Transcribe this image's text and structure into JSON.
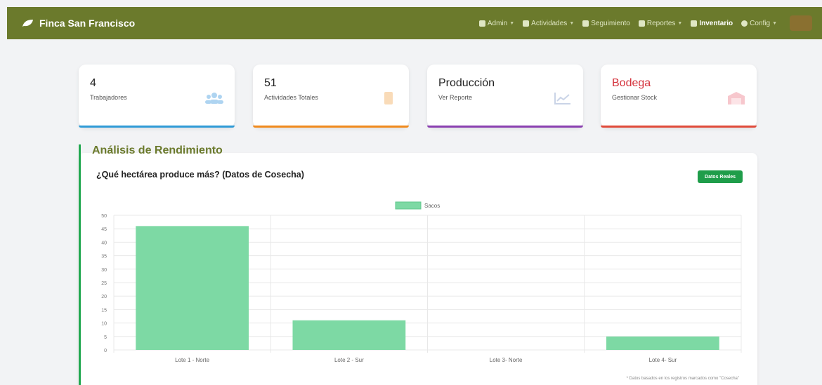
{
  "navbar": {
    "brand": "Finca San Francisco",
    "items": [
      {
        "label": "Admin",
        "icon": "user-icon",
        "dropdown": true
      },
      {
        "label": "Actividades",
        "icon": "check-icon",
        "dropdown": true
      },
      {
        "label": "Seguimiento",
        "icon": "list-icon",
        "dropdown": false
      },
      {
        "label": "Reportes",
        "icon": "file-icon",
        "dropdown": true
      },
      {
        "label": "Inventario",
        "icon": "boxes-icon",
        "dropdown": false
      },
      {
        "label": "Config",
        "icon": "gear-icon",
        "dropdown": true
      }
    ]
  },
  "cards": [
    {
      "value": "4",
      "label": "Trabajadores",
      "icon": "users-icon",
      "color": "#2f9bd6"
    },
    {
      "value": "51",
      "label": "Actividades Totales",
      "icon": "clipboard-icon",
      "color": "#f08a1c"
    },
    {
      "value": "Producción",
      "label": "Ver Reporte",
      "icon": "chart-line-icon",
      "color": "#8a3fb0"
    },
    {
      "value": "Bodega",
      "label": "Gestionar Stock",
      "icon": "warehouse-icon",
      "color": "#e04a3a"
    }
  ],
  "analysis": {
    "section_title": "Análisis de Rendimiento",
    "chart_title": "¿Qué hectárea produce más? (Datos de Cosecha)",
    "badge": "Datos Reales",
    "footnote": "* Datos basados en los registros marcados como \"Cosecha\""
  },
  "chart_data": {
    "type": "bar",
    "categories": [
      "Lote 1 - Norte",
      "Lote 2 - Sur",
      "Lote 3- Norte",
      "Lote 4- Sur"
    ],
    "series": [
      {
        "name": "Sacos",
        "values": [
          46,
          11,
          0,
          5
        ],
        "color": "#7dd9a4"
      }
    ],
    "ylim": [
      0,
      50
    ],
    "yticks": [
      0,
      5,
      10,
      15,
      20,
      25,
      30,
      35,
      40,
      45,
      50
    ],
    "grid": true,
    "legend": "top-center"
  }
}
